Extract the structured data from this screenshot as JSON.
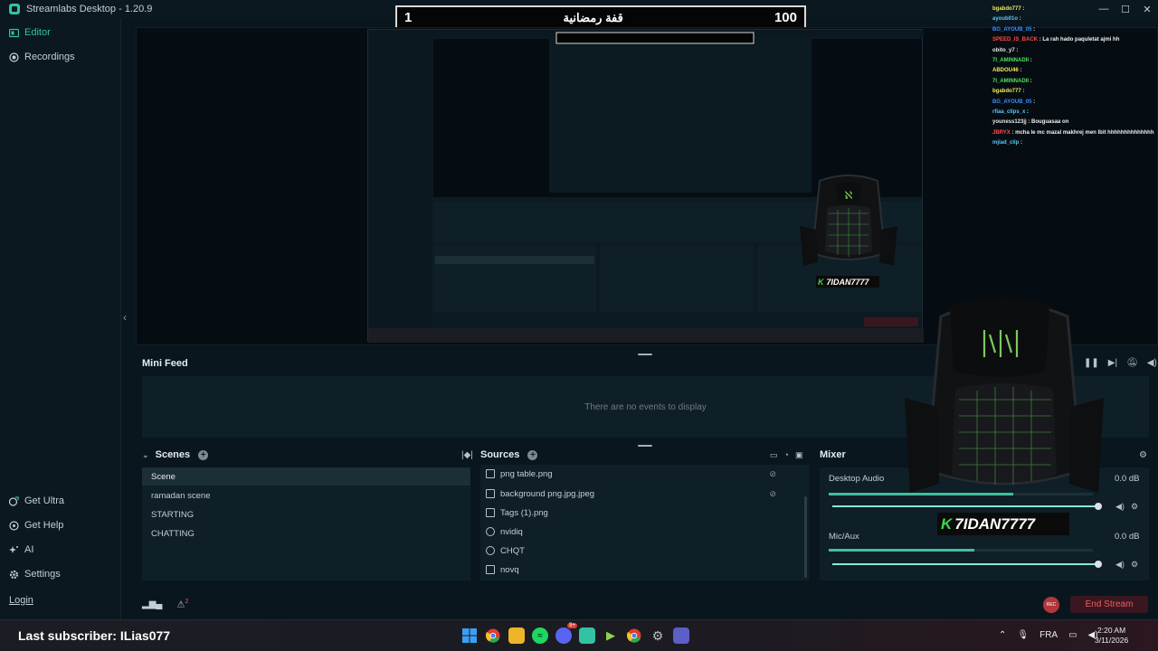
{
  "titlebar": {
    "title": "Streamlabs Desktop - 1.20.9",
    "minimize": "—",
    "maximize": "☐",
    "close": "✕"
  },
  "sidebar": {
    "top_items": [
      {
        "label": "Editor",
        "icon": "palette-icon"
      },
      {
        "label": "Recordings",
        "icon": "record-icon"
      }
    ],
    "bottom_items": [
      {
        "label": "Get Ultra",
        "icon": "ultra-icon"
      },
      {
        "label": "Get Help",
        "icon": "help-icon"
      },
      {
        "label": "AI",
        "icon": "sparkle-icon"
      },
      {
        "label": "Settings",
        "icon": "gear-icon"
      }
    ],
    "login": "Login"
  },
  "overlay": {
    "score_left": "1",
    "score_title": "قفة رمضانية",
    "score_right": "100",
    "brand_name": "7IDAN7777",
    "brand_letter": "K",
    "preview_last_sub": "Last subscriber: ILias077"
  },
  "minifeed": {
    "title": "Mini Feed",
    "empty": "There are no events to display"
  },
  "scenes": {
    "title": "Scenes",
    "items": [
      "Scene",
      "ramadan scene",
      "STARTING",
      "CHATTING"
    ],
    "selected": "Scene"
  },
  "sources": {
    "title": "Sources",
    "items": [
      {
        "name": "png table.png",
        "icon": "image-icon",
        "hidden": true
      },
      {
        "name": "background png.jpg.jpeg",
        "icon": "image-icon",
        "hidden": true
      },
      {
        "name": "Tags (1).png",
        "icon": "image-icon",
        "hidden": false
      },
      {
        "name": "nvidiq",
        "icon": "webcam-icon",
        "hidden": false
      },
      {
        "name": "CHQT",
        "icon": "browser-source-icon",
        "hidden": false
      },
      {
        "name": "novq",
        "icon": "display-capture-icon",
        "hidden": false
      }
    ]
  },
  "mixer": {
    "title": "Mixer",
    "channels": [
      {
        "name": "Desktop Audio",
        "db": "0.0 dB",
        "level": 0.7,
        "volume": 1.0
      },
      {
        "name": "Mic/Aux",
        "db": "0.0 dB",
        "level": 0.55,
        "volume": 1.0
      }
    ]
  },
  "bottom": {
    "go_live": "REC",
    "end_stream": "End Stream",
    "alerts_count": "2"
  },
  "chat": [
    {
      "user": "bgabdo777",
      "color": "#f5ec5a",
      "msg": ":"
    },
    {
      "user": "ayoub01o",
      "color": "#5ac8fa",
      "msg": ":"
    },
    {
      "user": "BG_AYOUB_05",
      "color": "#3f8cff",
      "msg": ":"
    },
    {
      "user": "SPEED_IS_BACK",
      "color": "#ff4a4a",
      "msg": ": La rah hado paquletat ajmi hh"
    },
    {
      "user": "obito_y7",
      "color": "#e6e6e6",
      "msg": ":"
    },
    {
      "user": "7I_AMINNADII",
      "color": "#52e35a",
      "msg": ":"
    },
    {
      "user": "ABDOU46",
      "color": "#f5ec5a",
      "msg": ":"
    },
    {
      "user": "7I_AMINNADII",
      "color": "#52e35a",
      "msg": ":"
    },
    {
      "user": "bgabdo777",
      "color": "#f5ec5a",
      "msg": ":"
    },
    {
      "user": "BG_AYOUB_05",
      "color": "#3f8cff",
      "msg": ":"
    },
    {
      "user": "rfiaa_clips_x",
      "color": "#5ac8fa",
      "msg": ":"
    },
    {
      "user": "youness123jj",
      "color": "#e6e6e6",
      "msg": ": Bouguasaa on"
    },
    {
      "user": "JBRYX",
      "color": "#ff4a4a",
      "msg": ": mcha le mc mazal makhrej men lbit hhhhhhhhhhhhhh"
    },
    {
      "user": "mjiad_clip",
      "color": "#5ac8fa",
      "msg": ":"
    }
  ],
  "taskbar": {
    "last_subscriber": "Last subscriber: ILias077",
    "lang": "FRA",
    "time": "2:20 AM",
    "date": "3/11/2026",
    "apps": [
      "windows-start-icon",
      "chrome-icon",
      "file-explorer-icon",
      "spotify-icon",
      "discord-icon",
      "streamlabs-icon",
      "play-icon",
      "chrome-icon-2",
      "settings-icon",
      "teams-icon"
    ],
    "discord_badge": "9+"
  }
}
